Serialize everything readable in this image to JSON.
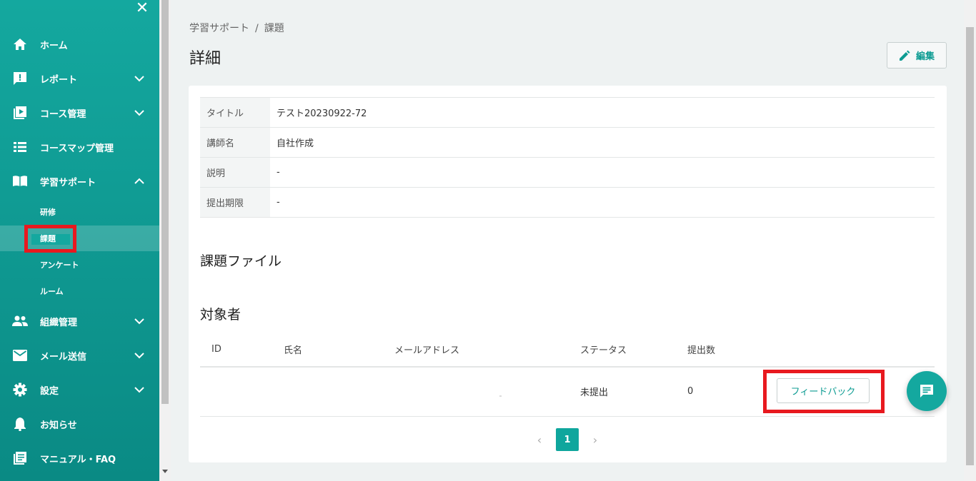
{
  "sidebar": {
    "close_label": "✕",
    "items": [
      {
        "label": "ホーム",
        "icon": "home-icon"
      },
      {
        "label": "レポート",
        "icon": "report-icon"
      },
      {
        "label": "コース管理",
        "icon": "course-icon"
      },
      {
        "label": "コースマップ管理",
        "icon": "list-icon"
      },
      {
        "label": "学習サポート",
        "icon": "book-icon"
      },
      {
        "label": "組織管理",
        "icon": "people-icon"
      },
      {
        "label": "メール送信",
        "icon": "mail-icon"
      },
      {
        "label": "設定",
        "icon": "gear-icon"
      },
      {
        "label": "お知らせ",
        "icon": "bell-icon"
      },
      {
        "label": "マニュアル・FAQ",
        "icon": "manual-icon"
      }
    ],
    "sub_items": [
      {
        "label": "研修"
      },
      {
        "label": "課題"
      },
      {
        "label": "アンケート"
      },
      {
        "label": "ルーム"
      }
    ]
  },
  "breadcrumb": {
    "parent": "学習サポート",
    "separator": "/",
    "current": "課題"
  },
  "page": {
    "title": "詳細",
    "edit_label": "編集"
  },
  "info": [
    {
      "label": "タイトル",
      "value": "テスト20230922-72"
    },
    {
      "label": "講師名",
      "value": "自社作成"
    },
    {
      "label": "説明",
      "value": "-"
    },
    {
      "label": "提出期限",
      "value": "-"
    }
  ],
  "sections": {
    "files_title": "課題ファイル",
    "targets_title": "対象者"
  },
  "targets": {
    "columns": [
      "ID",
      "氏名",
      "メールアドレス",
      "ステータス",
      "提出数"
    ],
    "rows": [
      {
        "id": "",
        "name": "",
        "email": "",
        "status": "未提出",
        "count": "0",
        "action": "フィードバック"
      }
    ]
  },
  "pagination": {
    "prev": "‹",
    "current": "1",
    "next": "›"
  },
  "colors": {
    "accent": "#14a89f",
    "highlight": "#e8191f"
  }
}
